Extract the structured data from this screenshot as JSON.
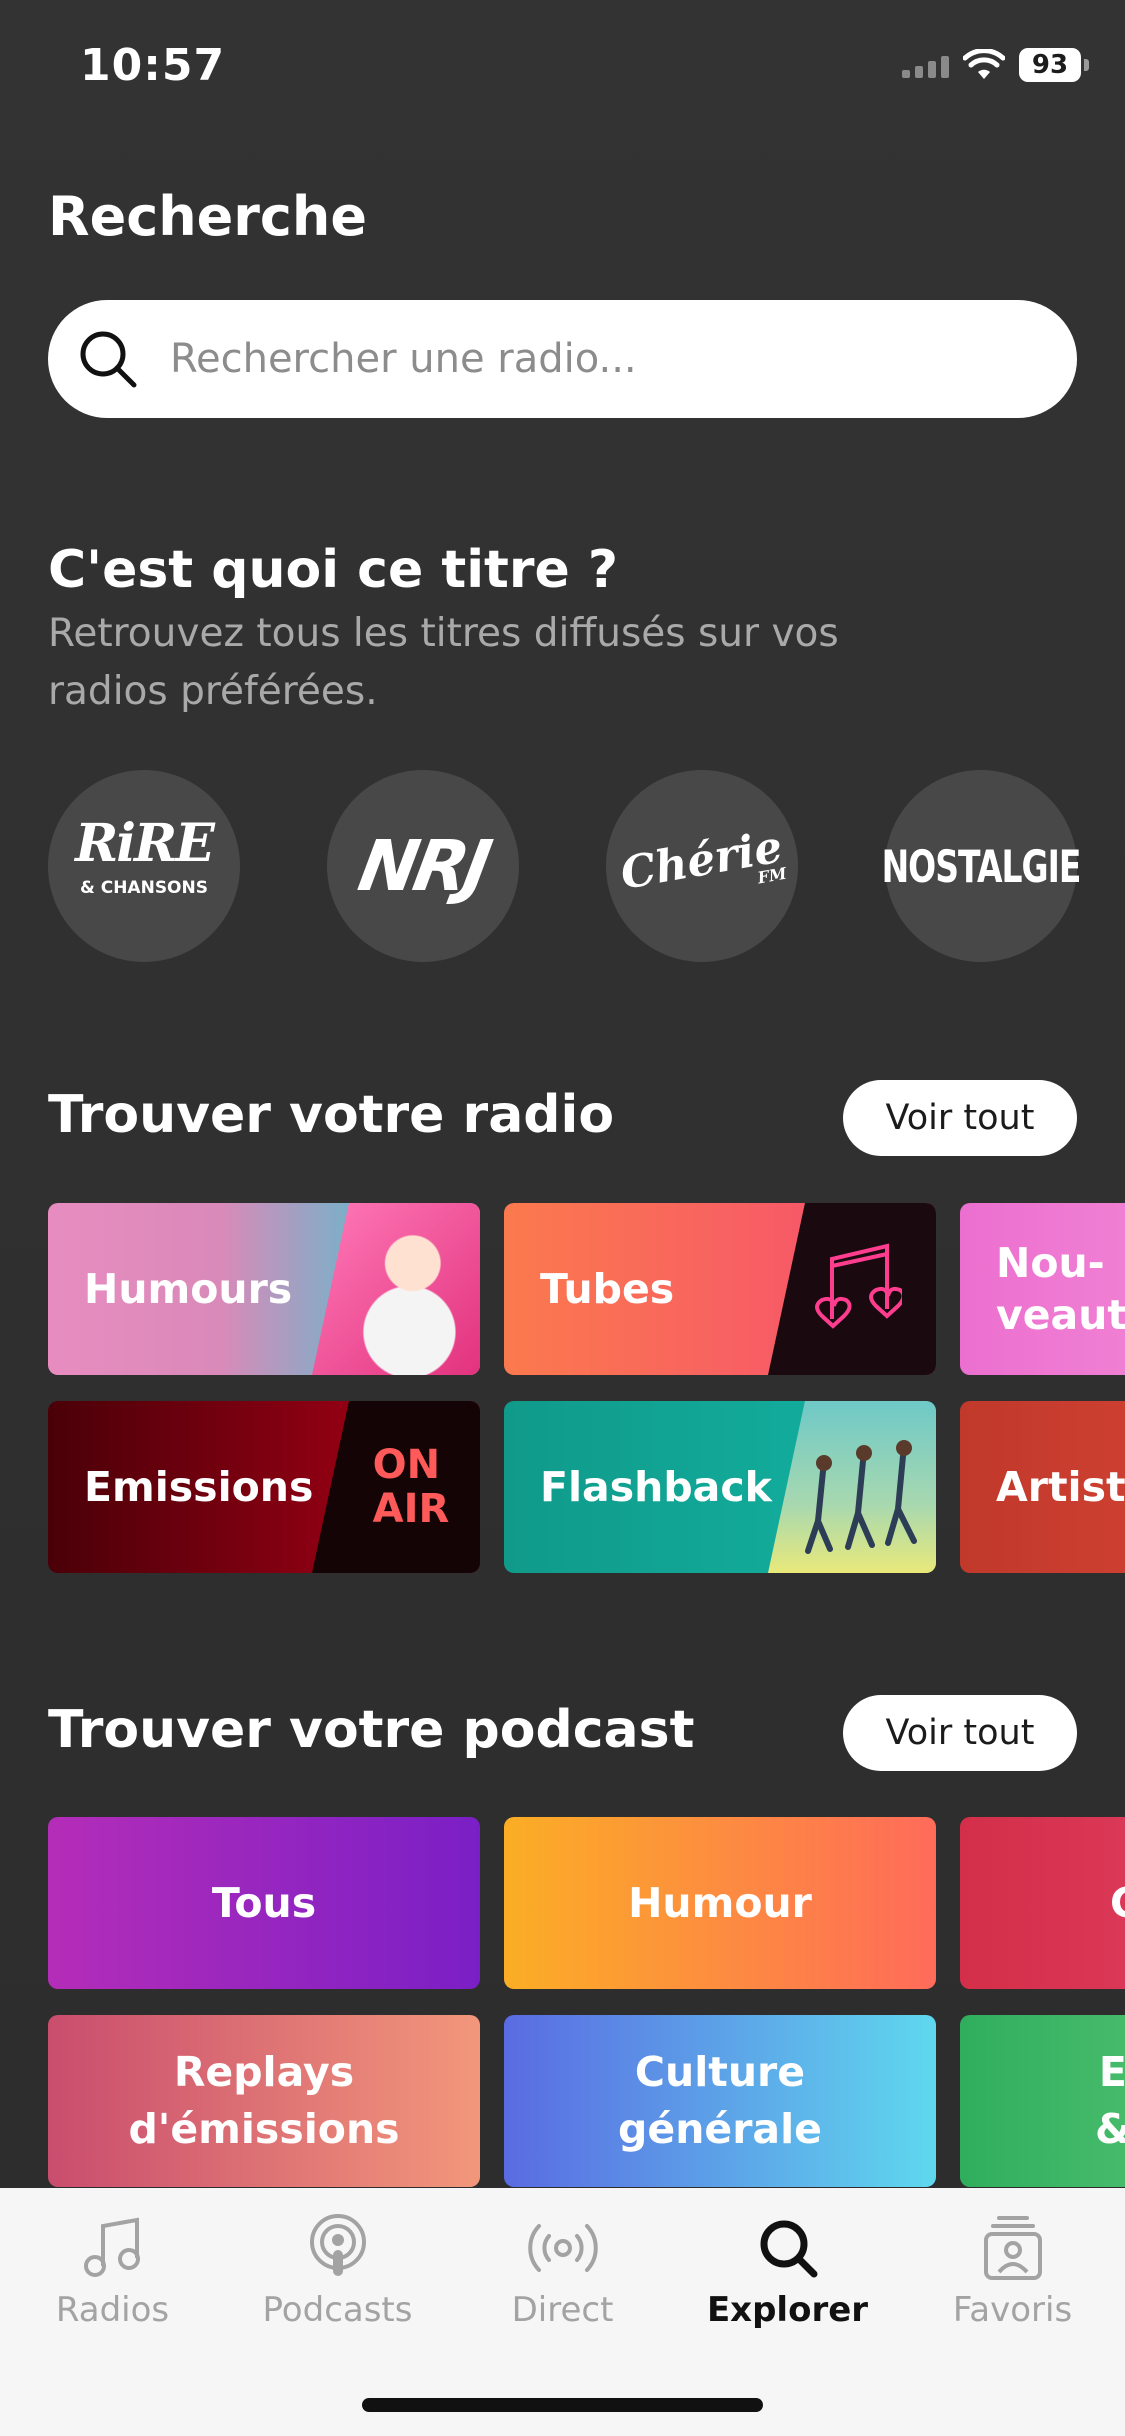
{
  "status_bar": {
    "time": "10:57",
    "battery": "93"
  },
  "page_title": "Recherche",
  "search": {
    "placeholder": "Rechercher une radio..."
  },
  "identify": {
    "title": "C'est quoi ce titre ?",
    "subtitle": "Retrouvez tous les titres diffusés sur vos radios préférées.",
    "stations": [
      {
        "line1": "RiRE",
        "line2": "& CHANSONS"
      },
      {
        "name": "NRJ"
      },
      {
        "name": "Chérie",
        "tag": "FM"
      },
      {
        "name": "NOSTALGIE"
      }
    ]
  },
  "radio_section": {
    "title": "Trouver votre radio",
    "see_all": "Voir tout",
    "categories": [
      {
        "label": "Humours"
      },
      {
        "label": "Tubes"
      },
      {
        "label": "Nou-\nveautés"
      },
      {
        "label": "Emissions",
        "art_text": "ON\nAIR"
      },
      {
        "label": "Flashback"
      },
      {
        "label": "Artistes"
      }
    ]
  },
  "podcast_section": {
    "title": "Trouver votre podcast",
    "see_all": "Voir tout",
    "categories": [
      {
        "label": "Tous"
      },
      {
        "label": "Humour"
      },
      {
        "label": "C"
      },
      {
        "label": "Replays\nd'émissions"
      },
      {
        "label": "Culture\ngénérale"
      },
      {
        "label": "E\n&"
      }
    ]
  },
  "tabbar": {
    "items": [
      {
        "label": "Radios",
        "icon": "music-note-icon"
      },
      {
        "label": "Podcasts",
        "icon": "podcast-icon"
      },
      {
        "label": "Direct",
        "icon": "broadcast-icon"
      },
      {
        "label": "Explorer",
        "icon": "search-icon",
        "active": true
      },
      {
        "label": "Favoris",
        "icon": "favorites-icon"
      }
    ]
  }
}
